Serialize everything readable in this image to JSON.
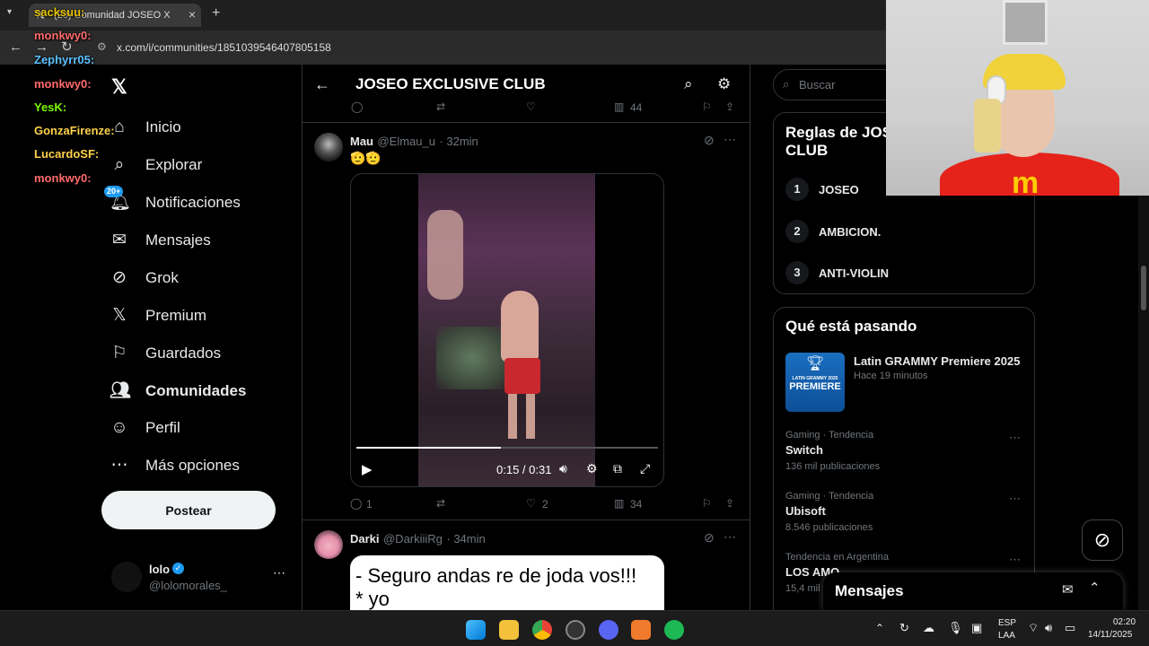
{
  "browser": {
    "tab_title": "(20) Comunidad JOSEO X",
    "url": "x.com/i/communities/1851039546407805158"
  },
  "chat_overlay": [
    {
      "user": "sacksuu:",
      "msg": "",
      "color": "#e6c300"
    },
    {
      "user": "monkwy0:",
      "msg": "",
      "color": "#ff6b6b"
    },
    {
      "user": "Zephyrr05:",
      "msg": "",
      "color": "#5bc0ff"
    },
    {
      "user": "monkwy0:",
      "msg": "",
      "color": "#ff6b6b"
    },
    {
      "user": "YesK:",
      "msg": "",
      "color": "#7CFC00"
    },
    {
      "user": "GonzaFirenze:",
      "msg": "",
      "color": "#ffd24a"
    },
    {
      "user": "LucardoSF:",
      "msg": "",
      "color": "#ffd24a"
    },
    {
      "user": "monkwy0:",
      "msg": "",
      "color": "#ff6b6b"
    }
  ],
  "sidebar": {
    "notif_badge": "20+",
    "items": [
      {
        "label": "Inicio",
        "icon": "home-icon"
      },
      {
        "label": "Explorar",
        "icon": "search-icon"
      },
      {
        "label": "Notificaciones",
        "icon": "bell-icon"
      },
      {
        "label": "Mensajes",
        "icon": "mail-icon"
      },
      {
        "label": "Grok",
        "icon": "grok-icon"
      },
      {
        "label": "Premium",
        "icon": "x-icon"
      },
      {
        "label": "Guardados",
        "icon": "bookmark-icon"
      },
      {
        "label": "Comunidades",
        "icon": "people-icon"
      },
      {
        "label": "Perfil",
        "icon": "person-icon"
      },
      {
        "label": "Más opciones",
        "icon": "more-icon"
      }
    ],
    "post_label": "Postear",
    "account": {
      "name": "lolo",
      "handle": "@lolomorales_"
    }
  },
  "header": {
    "title": "JOSEO EXCLUSIVE CLUB"
  },
  "prev_post_metrics": {
    "views": "44"
  },
  "posts": [
    {
      "name": "Mau",
      "handle": "@Elmau_u",
      "time": "· 32min",
      "text": "🫡🫡",
      "video_time": "0:15 / 0:31",
      "video_progress": 0.48,
      "replies": "1",
      "likes": "2",
      "views": "34"
    },
    {
      "name": "Darki",
      "handle": "@DarkiiiRg",
      "time": "· 34min",
      "image_text_line1": "- Seguro andas re de joda vos!!!",
      "image_text_line2": "* yo"
    }
  ],
  "right": {
    "search_placeholder": "Buscar",
    "rules_title_line1": "Reglas de JOS",
    "rules_title_line2": "CLUB",
    "rules": [
      {
        "n": "1",
        "text": "JOSEO"
      },
      {
        "n": "2",
        "text": "AMBICION."
      },
      {
        "n": "3",
        "text": "ANTI-VIOLIN"
      }
    ],
    "trends_title": "Qué está pasando",
    "featured": {
      "title": "Latin GRAMMY Premiere 2025",
      "time": "Hace 19 minutos",
      "badge_line1": "LATIN GRAMMY 2025",
      "badge_line2": "PREMIERE"
    },
    "trends": [
      {
        "cat": "Gaming · Tendencia",
        "name": "Switch",
        "count": "136 mil publicaciones"
      },
      {
        "cat": "Gaming · Tendencia",
        "name": "Ubisoft",
        "count": "8.546 publicaciones"
      },
      {
        "cat": "Tendencia en Argentina",
        "name": "LOS AMO",
        "count": "15,4 mil"
      }
    ],
    "messages_label": "Mensajes"
  },
  "taskbar": {
    "lang1": "ESP",
    "lang2": "LAA",
    "time": "02:20",
    "date": "14/11/2025"
  }
}
